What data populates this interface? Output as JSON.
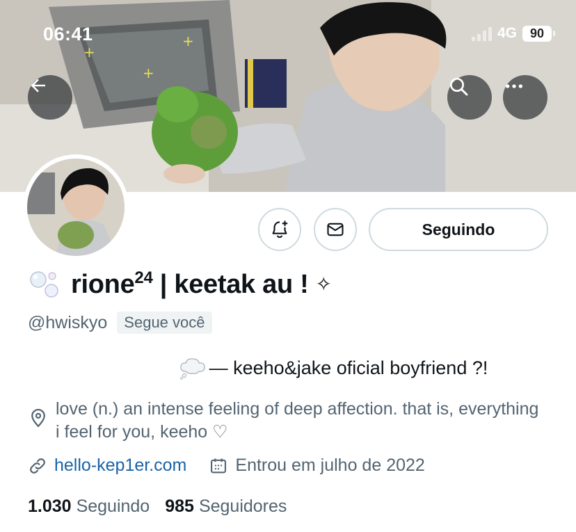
{
  "status_bar": {
    "time": "06:41",
    "network": "4G",
    "battery": "90"
  },
  "header": {
    "back_icon": "arrow-left-icon",
    "search_icon": "search-icon",
    "more_icon": "more-horizontal-icon"
  },
  "actions": {
    "notify_icon": "bell-plus-icon",
    "message_icon": "mail-icon",
    "following_label": "Seguindo"
  },
  "profile": {
    "name_emoji": "bubbles-icon",
    "display_name": "rione",
    "display_name_sup": "24",
    "display_name_rest": " | keetak au !",
    "sparkle": "✧",
    "handle": "@hwiskyo",
    "follows_you": "Segue você",
    "bio_emoji": "thought-balloon-icon",
    "bio": "— keeho&jake oficial boyfriend ?!",
    "location": "love (n.) an intense feeling of deep affection. that is, everything i feel for you, keeho ♡",
    "link": "hello-kep1er.com",
    "joined": "Entrou em julho de 2022"
  },
  "stats": {
    "following_count": "1.030",
    "following_label": "Seguindo",
    "followers_count": "985",
    "followers_label": "Seguidores"
  },
  "colors": {
    "text_primary": "#0f1419",
    "text_secondary": "#536471",
    "link": "#1a63a8",
    "border": "#cfd9de"
  }
}
